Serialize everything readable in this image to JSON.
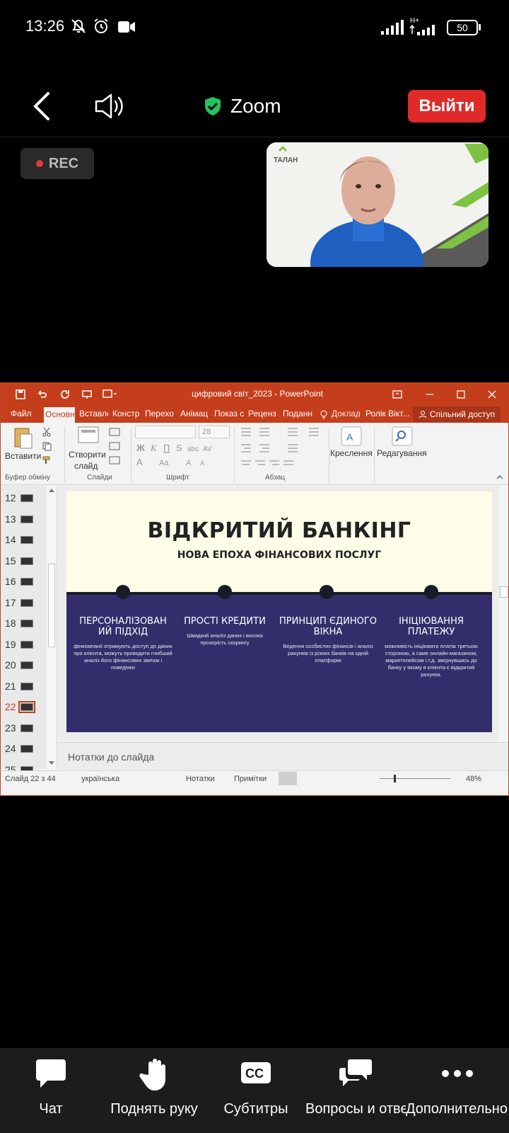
{
  "status_bar": {
    "time": "13:26",
    "network": "H+",
    "battery": "50"
  },
  "header": {
    "title": "Zoom",
    "exit_label": "Выйти"
  },
  "recording": {
    "label": "REC"
  },
  "video": {
    "logo_text": "ТАЛАН"
  },
  "ppt": {
    "doc_title": "цифровий світ_2023 - PowerPoint",
    "tabs": [
      "Файл",
      "Основн",
      "Вставле",
      "Констр",
      "Перехо",
      "Анімац",
      "Показ с",
      "Реценз",
      "Поданн",
      "Доклад",
      "Ролік Вікт...",
      "Спільний доступ"
    ],
    "ribbon": {
      "paste": "Вставити",
      "new_slide_1": "Створити",
      "new_slide_2": "слайд",
      "font_size": "28",
      "draw": "Креслення",
      "edit": "Редагування",
      "group_clipboard": "Буфер обміну",
      "group_slides": "Слайди",
      "group_font": "Шрифт",
      "group_paragraph": "Абзац"
    },
    "thumbnails": [
      "12",
      "13",
      "14",
      "15",
      "16",
      "17",
      "18",
      "19",
      "20",
      "21",
      "22",
      "23",
      "24",
      "25"
    ],
    "selected_slide": "22",
    "slide": {
      "title": "ВІДКРИТИЙ БАНКІНГ",
      "subtitle": "НОВА ЕПОХА ФІНАНСОВИХ ПОСЛУГ",
      "columns": [
        {
          "heading": "ПЕРСОНАЛІЗОВАН ИЙ ПІДХІД",
          "text": "фінкомпанії отримують доступ до даних про клієнта, можуть проводити глибший аналіз його фінансових звичок і поведінки"
        },
        {
          "heading": "ПРОСТІ КРЕДИТИ",
          "text": "Швидкий аналіз даних і висока прозорість скорингу"
        },
        {
          "heading": "ПРИНЦИП ЄДИНОГО ВІКНА",
          "text": "Ведення особистих фінансів і аналіз рахунків із різних банків на одній платформі"
        },
        {
          "heading": "ІНІЦІЮВАННЯ ПЛАТЕЖУ",
          "text": "можливість ініціювати платіж третьою стороною, а саме онлайн-магазином, маркетплейсом і.т.д. звернувшись до банку у якому в клієнта є відкритий рахунок."
        }
      ]
    },
    "notes_placeholder": "Нотатки до слайда",
    "status": {
      "slide_counter": "Слайд 22 з 44",
      "language": "українська",
      "notes": "Нотатки",
      "comments": "Примітки",
      "zoom": "48%"
    }
  },
  "toolbar": {
    "chat": "Чат",
    "raise_hand": "Поднять руку",
    "subtitles": "Субтитры",
    "qa": "Вопросы и отве",
    "more": "Дополнительно"
  }
}
